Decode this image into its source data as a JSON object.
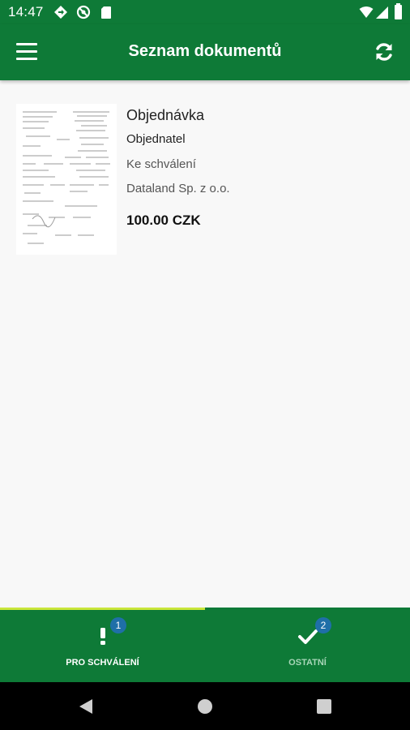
{
  "status_bar": {
    "time": "14:47",
    "left_icons": [
      "diamond-nav-icon",
      "blocked-circle-icon",
      "sd-card-icon"
    ],
    "right_icons": [
      "wifi-icon",
      "signal-icon",
      "battery-icon"
    ]
  },
  "app_bar": {
    "title": "Seznam dokumentů",
    "menu_icon": "hamburger-menu-icon",
    "refresh_icon": "refresh-icon"
  },
  "documents": [
    {
      "title": "Objednávka",
      "orderer": "Objednatel",
      "state": "Ke schválení",
      "company": "Dataland Sp. z o.o.",
      "amount": "100.00 CZK"
    }
  ],
  "bottom_nav": {
    "tabs": [
      {
        "label": "PRO SCHVÁLENÍ",
        "badge": "1",
        "icon": "exclamation-icon",
        "active": true
      },
      {
        "label": "OSTATNÍ",
        "badge": "2",
        "icon": "checkmark-icon",
        "active": false
      }
    ]
  },
  "colors": {
    "primary": "#0e7a37",
    "indicator": "#c9e63a",
    "badge": "#1f6fa8",
    "background": "#f8f8f8"
  },
  "system_nav": [
    "back-icon",
    "home-icon",
    "recents-icon"
  ]
}
